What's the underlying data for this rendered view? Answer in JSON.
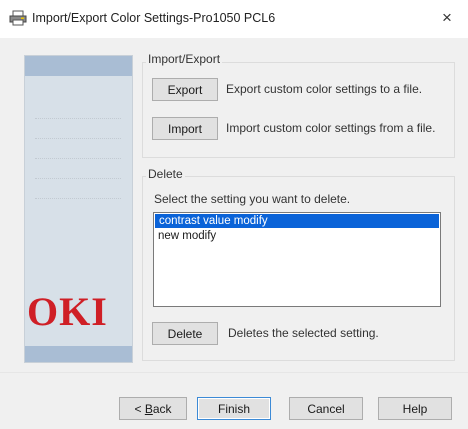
{
  "window": {
    "title": "Import/Export Color Settings-Pro1050 PCL6",
    "close_glyph": "×"
  },
  "brand": {
    "logo_text": "OKI",
    "logo_color": "#cf1f26"
  },
  "import_export": {
    "group_title": "Import/Export",
    "export_label": "Export",
    "export_desc": "Export custom color settings to a file.",
    "import_label": "Import",
    "import_desc": "Import custom color settings from a file."
  },
  "delete_group": {
    "group_title": "Delete",
    "instruction": "Select the setting you want to delete.",
    "items": [
      {
        "label": "contrast value modify",
        "selected": true
      },
      {
        "label": "new modify",
        "selected": false
      }
    ],
    "delete_label": "Delete",
    "delete_desc": "Deletes the selected setting."
  },
  "footer": {
    "back_prefix": "< ",
    "back_mnemonic": "B",
    "back_rest": "ack",
    "finish_label": "Finish",
    "cancel_label": "Cancel",
    "help_label": "Help"
  },
  "colors": {
    "selection": "#0a63d8",
    "focus_border": "#3c8ad6"
  }
}
